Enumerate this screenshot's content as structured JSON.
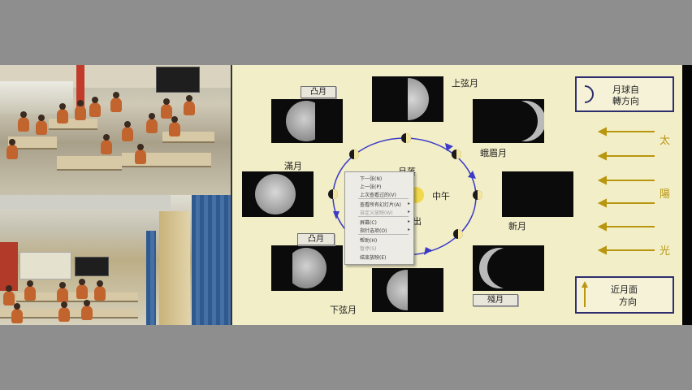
{
  "slide": {
    "phase_labels": {
      "waxing_gibbous": "凸月",
      "first_quarter": "上弦月",
      "waxing_crescent": "蛾眉月",
      "full_moon": "滿月",
      "new_moon": "新月",
      "waning_gibbous": "凸月",
      "last_quarter": "下弦月",
      "waning_crescent": "殘月"
    },
    "center_labels": {
      "moonset": "月落",
      "noon": "中午",
      "moonrise_partial": "出"
    },
    "legend_rotation": [
      "月球自",
      "轉方向"
    ],
    "legend_near_face": [
      "近月面",
      "方向"
    ],
    "sunlight_chars": [
      "太",
      "陽",
      "光"
    ]
  },
  "context_menu": {
    "items": [
      {
        "label": "下一张(N)",
        "disabled": false,
        "submenu": false
      },
      {
        "label": "上一张(P)",
        "disabled": false,
        "submenu": false
      },
      {
        "label": "上次查看过的(V)",
        "disabled": false,
        "submenu": false
      },
      {
        "label": "查看所有幻灯片(A)",
        "disabled": false,
        "submenu": true
      },
      {
        "label": "自定义放映(W)",
        "disabled": true,
        "submenu": true
      },
      {
        "label": "屏幕(C)",
        "disabled": false,
        "submenu": true
      },
      {
        "label": "指针选项(O)",
        "disabled": false,
        "submenu": true
      },
      {
        "label": "帮助(H)",
        "disabled": false,
        "submenu": false
      },
      {
        "label": "暂停(S)",
        "disabled": true,
        "submenu": false
      },
      {
        "label": "结束放映(E)",
        "disabled": false,
        "submenu": false
      }
    ]
  },
  "colors": {
    "slide_bg": "#f2eec8",
    "orbit": "#3b3bc8",
    "sun_arrow": "#b8960f",
    "student_uniform": "#c2642e"
  },
  "icons": [
    "crescent-rotation-icon",
    "up-arrow-icon",
    "sun-icon",
    "submenu-arrow-icon"
  ]
}
